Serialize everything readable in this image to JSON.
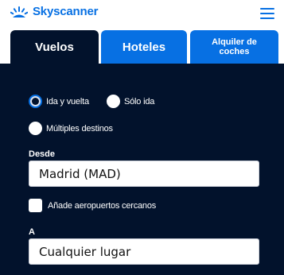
{
  "header": {
    "brand": "Skyscanner",
    "logo_icon": "sunrise-logo-icon",
    "menu_icon": "hamburger-menu-icon",
    "brand_color": "#0770e3"
  },
  "tabs": [
    {
      "label": "Vuelos",
      "active": true
    },
    {
      "label": "Hoteles",
      "active": false
    },
    {
      "label": "Alquiler de coches",
      "active": false
    }
  ],
  "trip_type": {
    "options": [
      {
        "label": "Ida y vuelta",
        "selected": true
      },
      {
        "label": "Sólo ida",
        "selected": false
      },
      {
        "label": "Múltiples destinos",
        "selected": false
      }
    ]
  },
  "from": {
    "label": "Desde",
    "value": "Madrid (MAD)"
  },
  "nearby_airports": {
    "label": "Añade aeropuertos cercanos",
    "checked": false
  },
  "to": {
    "label": "A",
    "value": "Cualquier lugar"
  },
  "colors": {
    "panel_bg": "#02122c",
    "tab_inactive": "#0770e3"
  }
}
